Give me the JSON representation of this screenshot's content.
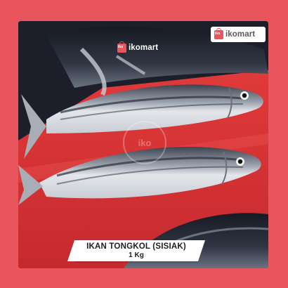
{
  "brand": {
    "name": "ikomart",
    "bag_label": "iko",
    "watermark": "iko"
  },
  "product": {
    "name": "IKAN TONGKOL (SISIAK)",
    "weight": "1 Kg"
  },
  "colors": {
    "background": "#e8555c",
    "caption_bg": "#ffffff",
    "caption_text": "#1e1e1e",
    "logo_text": "#5a5a5a",
    "tray": "#d93a3a"
  }
}
